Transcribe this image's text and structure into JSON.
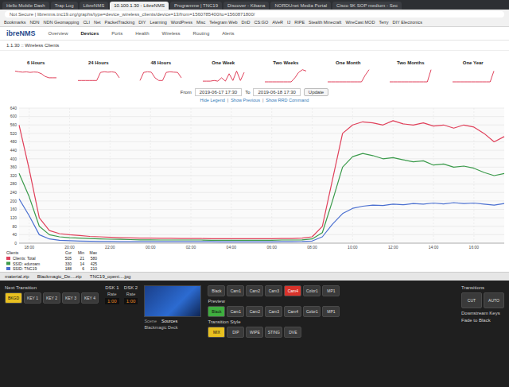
{
  "browser": {
    "tabs": [
      {
        "label": "Hello Mobile Dash",
        "selected": false
      },
      {
        "label": "Trap Log",
        "selected": false
      },
      {
        "label": "LibreNMS",
        "selected": false
      },
      {
        "label": "10.100.1.30 - LibreNMS",
        "selected": true
      },
      {
        "label": "Programme | TNC19",
        "selected": false
      },
      {
        "label": "Discover - Kibana",
        "selected": false
      },
      {
        "label": "NORDUnet Media Portal",
        "selected": false
      },
      {
        "label": "Cisco 9K SOP medium - Sec",
        "selected": false
      }
    ],
    "address": "Not Secure | librenms.tnc19.org/graphs/type=device_wireless_clients/device=13/from=1560785400/to=1560871800/",
    "bookmarks": [
      "Bookmarks",
      "NDN",
      "NDN Geomapping",
      "CLI",
      "Net",
      "PacketTracking",
      "DIY",
      "Learning",
      "WordPress",
      "Misc",
      "Telegram Web",
      "DnD",
      "CS:GO",
      "AVeR",
      "IJ",
      "RIPE",
      "Stealth Minecraft",
      "WireCast MOD",
      "Terry",
      "DIY Electronics"
    ]
  },
  "app": {
    "logo": "ibreNMS",
    "nav": [
      {
        "label": "Overview",
        "selected": false
      },
      {
        "label": "Devices",
        "selected": true
      },
      {
        "label": "Ports",
        "selected": false
      },
      {
        "label": "Health",
        "selected": false
      },
      {
        "label": "Wireless",
        "selected": false
      },
      {
        "label": "Routing",
        "selected": false
      },
      {
        "label": "Alerts",
        "selected": false
      }
    ],
    "breadcrumb": "1.1.30 :: Wireless Clients"
  },
  "thumbnails": [
    {
      "label": "6 Hours",
      "values": [
        0.8,
        0.75,
        0.72,
        0.74,
        0.7,
        0.73,
        0.71,
        0.6,
        0.4,
        0.3,
        0.3,
        0.3
      ]
    },
    {
      "label": "24 Hours",
      "values": [
        0.1,
        0.1,
        0.1,
        0.1,
        0.1,
        0.1,
        0.7,
        0.75,
        0.72,
        0.74,
        0.7,
        0.3
      ]
    },
    {
      "label": "48 Hours",
      "values": [
        0.1,
        0.7,
        0.75,
        0.72,
        0.3,
        0.1,
        0.1,
        0.7,
        0.75,
        0.72,
        0.7,
        0.3
      ]
    },
    {
      "label": "One Week",
      "values": [
        0.05,
        0.05,
        0.05,
        0.1,
        0.05,
        0.3,
        0.05,
        0.6,
        0.1,
        0.8,
        0.1,
        0.7
      ]
    },
    {
      "label": "Two Weeks",
      "values": [
        0,
        0,
        0,
        0,
        0,
        0,
        0,
        0,
        0.3,
        0.7,
        0.9,
        0.8
      ]
    },
    {
      "label": "One Month",
      "values": [
        0,
        0,
        0,
        0,
        0,
        0,
        0,
        0,
        0,
        0,
        0.5,
        0.9
      ]
    },
    {
      "label": "Two Months",
      "values": [
        0,
        0,
        0,
        0,
        0,
        0,
        0,
        0,
        0,
        0,
        0,
        0.9
      ]
    },
    {
      "label": "One Year",
      "values": [
        0,
        0,
        0,
        0,
        0,
        0,
        0,
        0,
        0,
        0,
        0,
        0.8
      ]
    }
  ],
  "range": {
    "from_label": "From",
    "from": "2019-06-17 17:30",
    "to_label": "To",
    "to": "2019-06-18 17:30",
    "button": "Update"
  },
  "links": [
    "Hide Legend",
    "Show Previous",
    "Show RRD Command"
  ],
  "chart": {
    "y_ticks": [
      "0",
      "40",
      "80",
      "120",
      "160",
      "200",
      "240",
      "280",
      "320",
      "360",
      "400",
      "440",
      "480",
      "520",
      "560",
      "600",
      "640"
    ],
    "x_ticks": [
      "18:00",
      "20:00",
      "22:00",
      "00:00",
      "02:00",
      "04:00",
      "06:00",
      "08:00",
      "10:00",
      "12:00",
      "14:00",
      "16:00"
    ],
    "legend_title": "Clients",
    "legend_columns": [
      "Cur",
      "Min",
      "Max"
    ],
    "series": [
      {
        "name": "Clients: Total",
        "color": "#e0405a",
        "cur": "505",
        "min": "21",
        "max": "580",
        "values": [
          560,
          350,
          120,
          60,
          45,
          40,
          36,
          32,
          30,
          28,
          26,
          25,
          24,
          24,
          23,
          23,
          22,
          22,
          22,
          21,
          21,
          21,
          21,
          21,
          21,
          21,
          22,
          22,
          24,
          30,
          80,
          300,
          520,
          560,
          575,
          570,
          560,
          580,
          565,
          560,
          570,
          555,
          560,
          545,
          560,
          550,
          520,
          480,
          505
        ]
      },
      {
        "name": "SSID: eduroam",
        "color": "#3a9a4a",
        "cur": "330",
        "min": "14",
        "max": "425",
        "values": [
          330,
          220,
          80,
          40,
          30,
          26,
          24,
          22,
          20,
          19,
          18,
          17,
          16,
          16,
          15,
          15,
          15,
          15,
          15,
          14,
          14,
          14,
          14,
          14,
          14,
          14,
          15,
          15,
          16,
          20,
          50,
          200,
          360,
          410,
          425,
          415,
          400,
          405,
          395,
          385,
          390,
          370,
          375,
          360,
          365,
          355,
          335,
          320,
          330
        ]
      },
      {
        "name": "SSID: TNC19",
        "color": "#4a6fd0",
        "cur": "188",
        "min": "6",
        "max": "210",
        "values": [
          210,
          130,
          40,
          20,
          14,
          12,
          10,
          9,
          8,
          8,
          7,
          7,
          7,
          7,
          7,
          7,
          7,
          7,
          7,
          7,
          6,
          6,
          6,
          6,
          6,
          6,
          7,
          7,
          8,
          10,
          30,
          90,
          140,
          165,
          175,
          180,
          178,
          185,
          182,
          188,
          185,
          190,
          186,
          192,
          188,
          190,
          185,
          180,
          188
        ]
      }
    ]
  },
  "downloads": [
    "material.zip",
    "Blackmagic_De....zip",
    "TNC19_openi....jpg"
  ],
  "switcher": {
    "next_transition": "Next Transition",
    "next_buttons": [
      {
        "label": "BKGD",
        "selected": true
      },
      {
        "label": "KEY 1",
        "selected": false
      },
      {
        "label": "KEY 2",
        "selected": false
      },
      {
        "label": "KEY 3",
        "selected": false
      },
      {
        "label": "KEY 4",
        "selected": false
      }
    ],
    "dsk": [
      {
        "label": "DSK 1",
        "rate_label": "Rate",
        "rate": "1:00"
      },
      {
        "label": "DSK 2",
        "rate_label": "Rate",
        "rate": "1:00"
      }
    ],
    "media_tabs": [
      {
        "label": "Scene",
        "selected": false
      },
      {
        "label": "Sources",
        "selected": true
      }
    ],
    "media_source": "Blackmagic Deck",
    "program": [
      {
        "label": "Black",
        "selected": false
      },
      {
        "label": "Cam1",
        "selected": false
      },
      {
        "label": "Cam2",
        "selected": false
      },
      {
        "label": "Cam3",
        "selected": false
      },
      {
        "label": "Cam4",
        "selected": true
      },
      {
        "label": "Color1",
        "selected": false
      },
      {
        "label": "MP1",
        "selected": false
      }
    ],
    "preview_label": "Preview",
    "preview": [
      {
        "label": "Black",
        "selected": true
      },
      {
        "label": "Cam1",
        "selected": false
      },
      {
        "label": "Cam2",
        "selected": false
      },
      {
        "label": "Cam3",
        "selected": false
      },
      {
        "label": "Cam4",
        "selected": false
      },
      {
        "label": "Color1",
        "selected": false
      },
      {
        "label": "MP1",
        "selected": false
      }
    ],
    "transition_style": "Transition Style",
    "styles": [
      {
        "label": "MIX",
        "selected": true
      },
      {
        "label": "DIP",
        "selected": false
      },
      {
        "label": "WIPE",
        "selected": false
      },
      {
        "label": "STING",
        "selected": false
      },
      {
        "label": "DVE",
        "selected": false
      }
    ],
    "transitions": "Transitions",
    "transition_buttons": [
      "CUT",
      "AUTO"
    ],
    "downstream": "Downstream Keys",
    "ftb": "Fade to Black"
  }
}
